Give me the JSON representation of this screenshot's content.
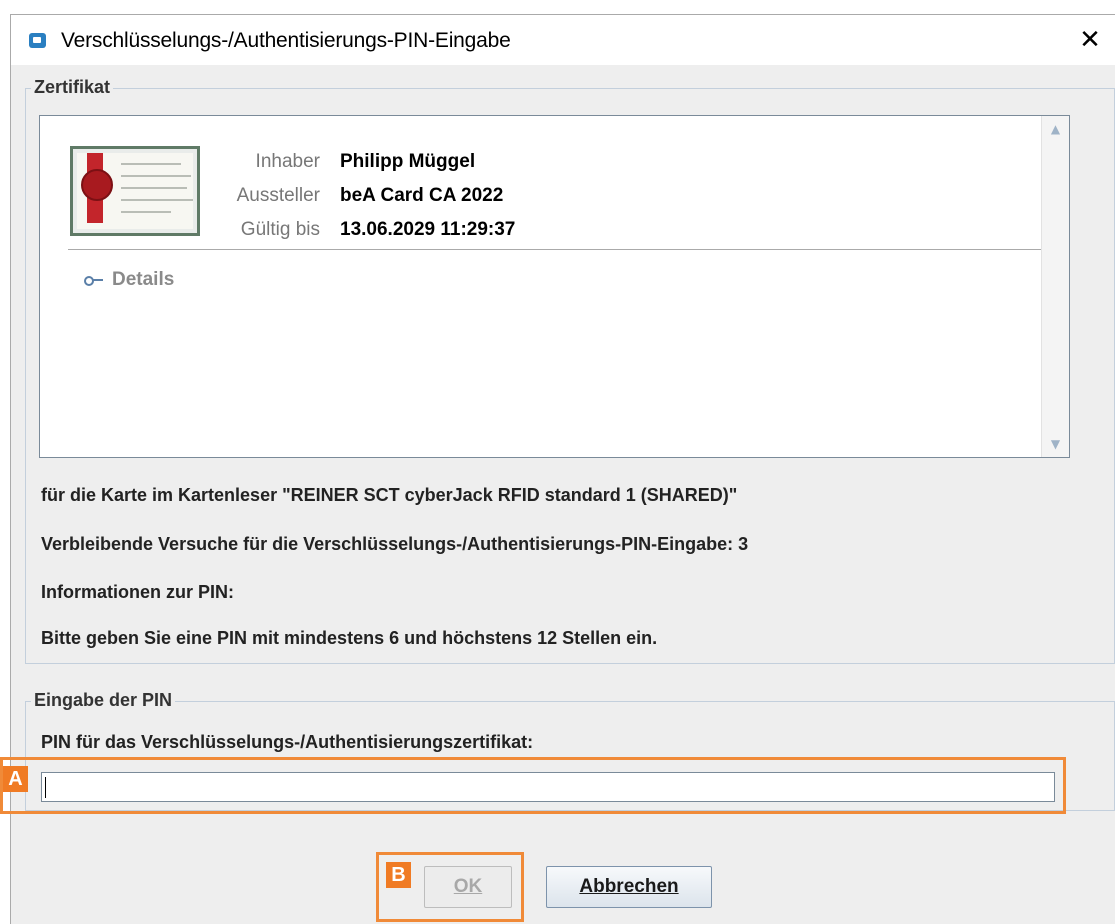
{
  "window": {
    "title": "Verschlüsselungs-/Authentisierungs-PIN-Eingabe",
    "close_glyph": "✕"
  },
  "certificate_group": {
    "legend": "Zertifikat",
    "fields": [
      {
        "label": "Inhaber",
        "value": "Philipp Müggel"
      },
      {
        "label": "Aussteller",
        "value": "beA Card CA 2022"
      },
      {
        "label": "Gültig bis",
        "value": "13.06.2029 11:29:37"
      }
    ],
    "details_link": "Details",
    "scroll_up_glyph": "▲",
    "scroll_down_glyph": "▼"
  },
  "info": {
    "card_reader": "für die Karte im Kartenleser \"REINER SCT cyberJack RFID standard 1 (SHARED)\"",
    "remaining_attempts": "Verbleibende Versuche für die Verschlüsselungs-/Authentisierungs-PIN-Eingabe: 3",
    "pin_info_heading": "Informationen zur PIN:",
    "pin_requirement": "Bitte geben Sie eine PIN mit mindestens 6 und höchstens 12 Stellen ein."
  },
  "pin_group": {
    "legend": "Eingabe der PIN",
    "field_label": "PIN für das Verschlüsselungs-/Authentisierungszertifikat:",
    "value": ""
  },
  "buttons": {
    "ok": "OK",
    "cancel": "Abbrechen"
  },
  "annotations": {
    "a": "A",
    "b": "B"
  },
  "colors": {
    "highlight": "#f08a38",
    "marker": "#f07b24",
    "window_bg": "#eeeeee"
  }
}
